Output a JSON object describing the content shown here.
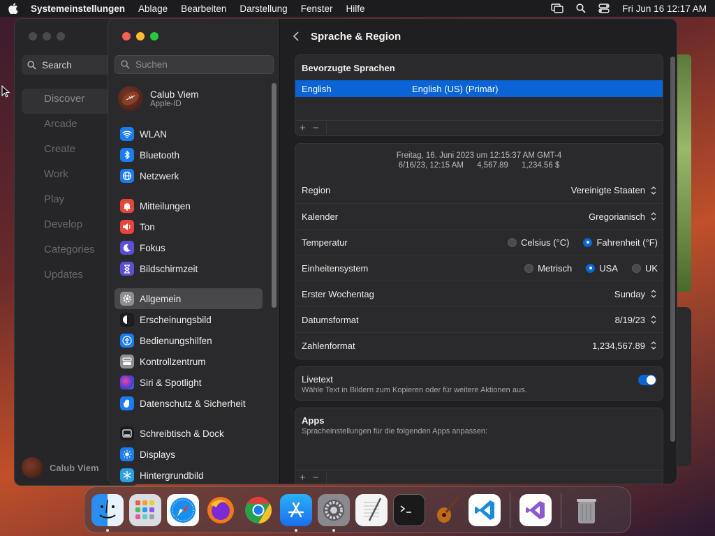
{
  "menubar": {
    "app_name": "Systemeinstellungen",
    "menus": [
      "Ablage",
      "Bearbeiten",
      "Darstellung",
      "Fenster",
      "Hilfe"
    ],
    "datetime": "Fri Jun 16  12:17 AM"
  },
  "appstore": {
    "search_label": "Search",
    "nav": [
      "Discover",
      "Arcade",
      "Create",
      "Work",
      "Play",
      "Develop",
      "Categories",
      "Updates"
    ],
    "user_name": "Calub Viem"
  },
  "sidebar": {
    "search_placeholder": "Suchen",
    "profile": {
      "name": "Calub Viem",
      "subtitle": "Apple-ID"
    },
    "groups": [
      [
        {
          "label": "WLAN",
          "icon": "wifi-icon",
          "color": "#1a7cf0"
        },
        {
          "label": "Bluetooth",
          "icon": "bluetooth-icon",
          "color": "#1a7cf0"
        },
        {
          "label": "Netzwerk",
          "icon": "globe-icon",
          "color": "#1a7cf0"
        }
      ],
      [
        {
          "label": "Mitteilungen",
          "icon": "bell-icon",
          "color": "#e5453a"
        },
        {
          "label": "Ton",
          "icon": "speaker-icon",
          "color": "#e5453a"
        },
        {
          "label": "Fokus",
          "icon": "moon-icon",
          "color": "#5b4fd6"
        },
        {
          "label": "Bildschirmzeit",
          "icon": "hourglass-icon",
          "color": "#5b4fd6"
        }
      ],
      [
        {
          "label": "Allgemein",
          "icon": "gear-icon",
          "color": "#8e8e93",
          "active": true
        },
        {
          "label": "Erscheinungsbild",
          "icon": "appearance-icon",
          "color": "#1c1c1e"
        },
        {
          "label": "Bedienungshilfen",
          "icon": "accessibility-icon",
          "color": "#1a7cf0"
        },
        {
          "label": "Kontrollzentrum",
          "icon": "control-center-icon",
          "color": "#8e8e93"
        },
        {
          "label": "Siri & Spotlight",
          "icon": "siri-icon",
          "color": "#7a3ad6"
        },
        {
          "label": "Datenschutz & Sicherheit",
          "icon": "hand-icon",
          "color": "#1a7cf0"
        }
      ],
      [
        {
          "label": "Schreibtisch & Dock",
          "icon": "dock-icon",
          "color": "#1c1c1e"
        },
        {
          "label": "Displays",
          "icon": "sun-icon",
          "color": "#1a7cf0"
        },
        {
          "label": "Hintergrundbild",
          "icon": "snowflake-icon",
          "color": "#2aa0e0"
        }
      ]
    ]
  },
  "main": {
    "title": "Sprache & Region",
    "preferred_languages": {
      "heading": "Bevorzugte Sprachen",
      "rows": [
        {
          "name": "English",
          "value": "English (US) (Primär)"
        }
      ]
    },
    "format_preview": {
      "line1": "Freitag, 16. Juni 2023 um 12:15:37 AM GMT-4",
      "line2": "6/16/23, 12:15 AM      4,567.89      1,234.56 $"
    },
    "settings": {
      "region": {
        "label": "Region",
        "value": "Vereinigte Staaten"
      },
      "calendar": {
        "label": "Kalender",
        "value": "Gregorianisch"
      },
      "temperature": {
        "label": "Temperatur",
        "options": [
          "Celsius (°C)",
          "Fahrenheit (°F)"
        ],
        "selected": 1
      },
      "measurement": {
        "label": "Einheitensystem",
        "options": [
          "Metrisch",
          "USA",
          "UK"
        ],
        "selected": 1
      },
      "first_weekday": {
        "label": "Erster Wochentag",
        "value": "Sunday"
      },
      "date_format": {
        "label": "Datumsformat",
        "value": "8/19/23"
      },
      "number_format": {
        "label": "Zahlenformat",
        "value": "1,234,567.89"
      }
    },
    "livetext": {
      "title": "Livetext",
      "description": "Wähle Text in Bildern zum Kopieren oder für weitere Aktionen aus.",
      "enabled": true
    },
    "apps": {
      "title": "Apps",
      "description": "Spracheinstellungen für die folgenden Apps anpassen:"
    },
    "plus": "+",
    "minus": "−"
  },
  "dock": {
    "apps": [
      "Finder",
      "Launchpad",
      "Safari",
      "Firefox",
      "Chrome",
      "App Store",
      "Systemeinstellungen",
      "TextEdit",
      "Terminal",
      "GarageBand",
      "Visual Studio Code",
      "Visual Studio",
      "Papierkorb"
    ]
  }
}
